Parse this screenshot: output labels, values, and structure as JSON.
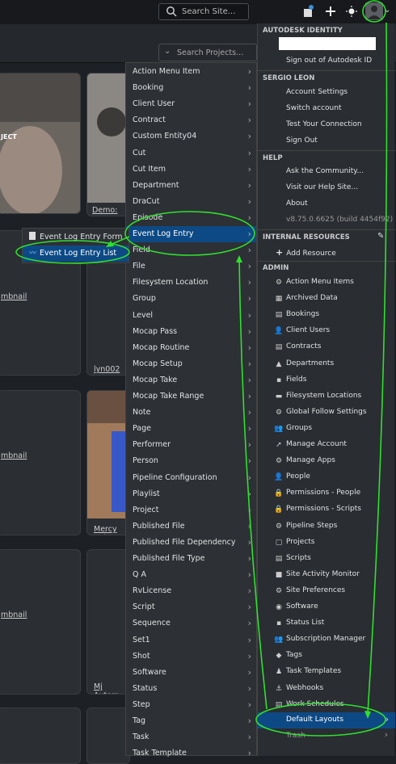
{
  "topbar": {
    "search_placeholder": "Search Site..."
  },
  "projects": {
    "search_placeholder": "Search Projects...",
    "cards": [
      {
        "label": "Demo: Au"
      },
      {
        "label": "lyn002"
      },
      {
        "label": "Mercy Ani"
      },
      {
        "label": "Mj Autom"
      }
    ],
    "thumb_labels": [
      "mbnail",
      "mbnail",
      "mbnail"
    ],
    "overlay_text": "JECT"
  },
  "entity_menu": {
    "items": [
      "Action Menu Item",
      "Booking",
      "Client User",
      "Contract",
      "Custom Entity04",
      "Cut",
      "Cut Item",
      "Department",
      "DraCut",
      "Episode",
      "Event Log Entry",
      "Field",
      "File",
      "Filesystem Location",
      "Group",
      "Level",
      "Mocap Pass",
      "Mocap Routine",
      "Mocap Setup",
      "Mocap Take",
      "Mocap Take Range",
      "Note",
      "Page",
      "Performer",
      "Person",
      "Pipeline Configuration",
      "Playlist",
      "Project",
      "Published File",
      "Published File Dependency",
      "Published File Type",
      "Q A",
      "RvLicense",
      "Script",
      "Sequence",
      "Set1",
      "Shot",
      "Software",
      "Status",
      "Step",
      "Tag",
      "Task",
      "Task Template"
    ],
    "active_index": 10
  },
  "event_submenu": {
    "items": [
      "Event Log Entry Form",
      "Event Log Entry List"
    ],
    "active_index": 1
  },
  "user_panel": {
    "autodesk_identity": "AUTODESK IDENTITY",
    "sign_out_autodesk": "Sign out of Autodesk ID",
    "user_name": "SERGIO LEON",
    "account_settings": "Account Settings",
    "switch_account": "Switch account",
    "test_connection": "Test Your Connection",
    "sign_out": "Sign Out",
    "help": "HELP",
    "ask_community": "Ask the Community...",
    "help_site": "Visit our Help Site...",
    "about": "About",
    "version": "v8.75.0.6625 (build 4454f92)",
    "internal_resources": "INTERNAL RESOURCES",
    "add_resource": "Add Resource",
    "admin": "ADMIN",
    "admin_items": [
      "Action Menu Items",
      "Archived Data",
      "Bookings",
      "Client Users",
      "Contracts",
      "Departments",
      "Fields",
      "Filesystem Locations",
      "Global Follow Settings",
      "Groups",
      "Manage Account",
      "Manage Apps",
      "People",
      "Permissions - People",
      "Permissions - Scripts",
      "Pipeline Steps",
      "Projects",
      "Scripts",
      "Site Activity Monitor",
      "Site Preferences",
      "Software",
      "Status List",
      "Subscription Manager",
      "Tags",
      "Task Templates",
      "Webhooks",
      "Work Schedules"
    ],
    "default_layouts": "Default Layouts",
    "trash": "Trash"
  },
  "colors": {
    "highlight": "#0d4a85",
    "annotation": "#2ee02e"
  }
}
